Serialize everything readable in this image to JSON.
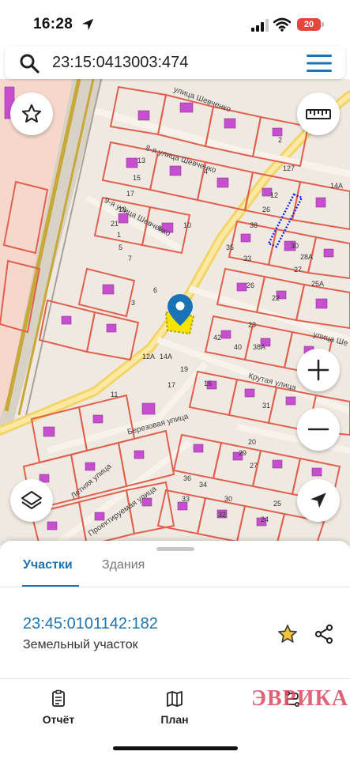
{
  "status_bar": {
    "time": "16:28",
    "battery": "20"
  },
  "search": {
    "query": "23:15:0413003:474"
  },
  "map": {
    "street_labels": [
      "8-я улица Шевченко",
      "9-я улица Шевченко",
      "улица Шевченко",
      "Крутая улица",
      "Березовая улица",
      "Летняя улица",
      "Проектируемая улица",
      "улица Ше"
    ],
    "parcel_numbers": [
      "127",
      "12",
      "14А",
      "26",
      "38",
      "30",
      "28А",
      "27",
      "25А",
      "35",
      "33",
      "2",
      "4",
      "13",
      "15",
      "17",
      "19",
      "21",
      "6",
      "8",
      "10",
      "5",
      "7",
      "3",
      "1",
      "12А",
      "14А",
      "19",
      "17",
      "16",
      "11",
      "40",
      "42",
      "23",
      "38А",
      "26",
      "22",
      "20",
      "31",
      "29",
      "27",
      "25",
      "24",
      "34",
      "36",
      "33",
      "30",
      "32"
    ]
  },
  "sheet": {
    "tabs": [
      {
        "label": "Участки",
        "active": true
      },
      {
        "label": "Здания",
        "active": false
      }
    ],
    "parcel": {
      "id": "23:45:0101142:182",
      "type": "Земельный участок"
    }
  },
  "bottom_nav": [
    {
      "label": "Отчёт",
      "icon": "report-icon"
    },
    {
      "label": "План",
      "icon": "map-plan-icon"
    },
    {
      "label": "",
      "icon": "route-icon"
    }
  ],
  "watermark": "ЭВРИКА",
  "colors": {
    "accent": "#1a73b5",
    "parcel_border": "#e0604f",
    "building": "#c64fd0",
    "road": "#f2d46a",
    "selection": "#f5e500"
  }
}
